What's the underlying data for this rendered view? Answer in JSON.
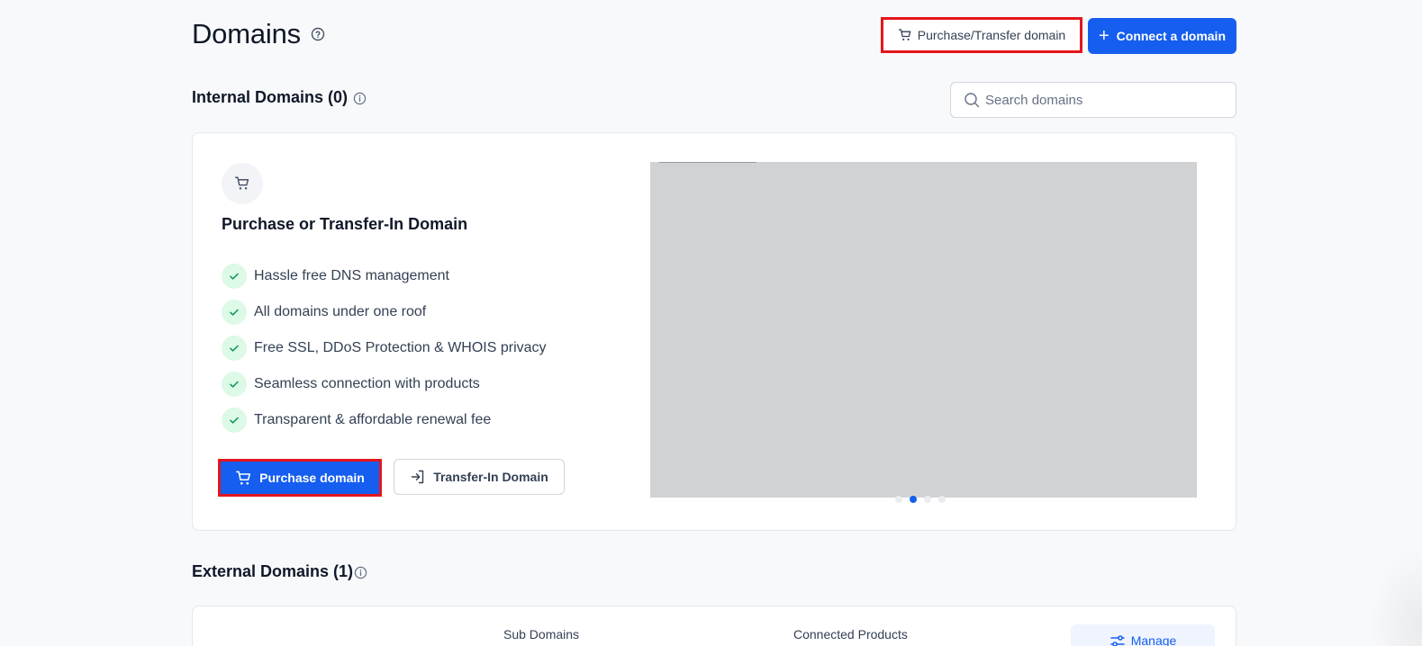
{
  "header": {
    "title": "Domains",
    "purchase_transfer_label": "Purchase/Transfer domain",
    "connect_label": "Connect a domain"
  },
  "internal": {
    "title": "Internal Domains (0)",
    "search_placeholder": "Search domains"
  },
  "promo": {
    "heading": "Purchase or Transfer-In Domain",
    "features": [
      "Hassle free DNS management",
      "All domains under one roof",
      "Free SSL, DDoS Protection & WHOIS privacy",
      "Seamless connection with products",
      "Transparent & affordable renewal fee"
    ],
    "purchase_label": "Purchase domain",
    "transfer_label": "Transfer-In Domain",
    "carousel": {
      "slides": 4,
      "active": 2
    }
  },
  "external": {
    "title": "External Domains (1)",
    "columns": [
      "Sub Domains",
      "Connected Products"
    ],
    "manage_label": "Manage"
  },
  "colors": {
    "primary": "#155eef",
    "highlight": "#e4161c",
    "check_bg": "#dcfae6",
    "check": "#12b76a"
  }
}
